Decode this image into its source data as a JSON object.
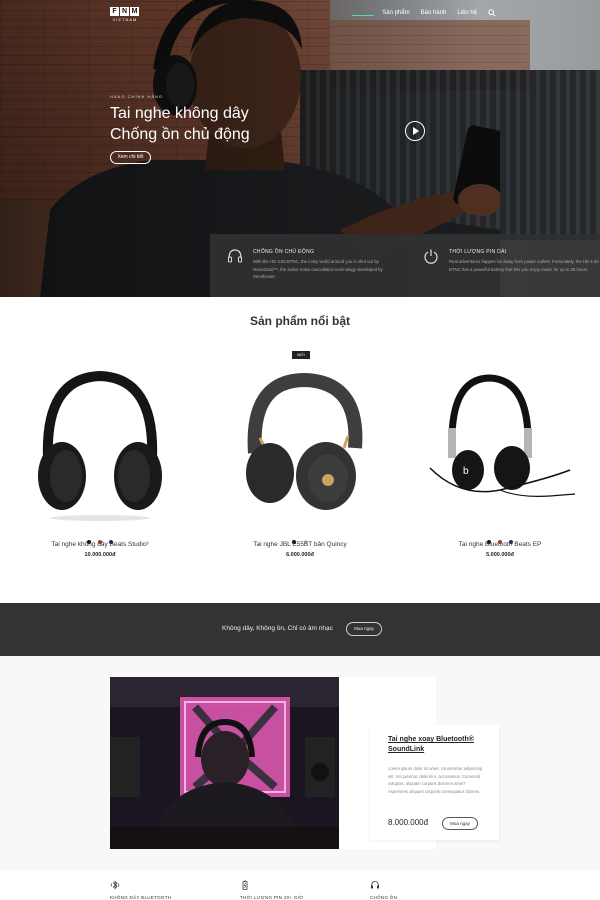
{
  "brand": {
    "logo_letters": [
      "F",
      "N",
      "M"
    ],
    "logo_sub": "VIETNAM"
  },
  "nav": {
    "items": [
      "Sản phẩm",
      "Bảo hành",
      "Liên hệ"
    ]
  },
  "hero": {
    "eyebrow": "HÀNG CHÍNH HÃNG",
    "title_line1": "Tai nghe không dây",
    "title_line2": "Chống ồn chủ động",
    "cta": "Xem chi tiết"
  },
  "hero_features": [
    {
      "icon": "headphones-icon",
      "title": "CHỐNG ỒN CHỦ ĐỘNG",
      "desc": "With the HD 4.50 BTNC, the noisy world around you is shut out by NoiseGard™, the active noise cancellation technology developed by Sennheiser."
    },
    {
      "icon": "power-icon",
      "title": "THỜI LƯỢNG PIN DÀI",
      "desc": "Real adventures happen far away from power outlets. Fortunately, the HD 4.50 BTNC has a powerful battery that lets you enjoy music for up to 25 hours."
    }
  ],
  "products_section": {
    "title": "Sản phẩm nổi bật",
    "badge": "MỚI"
  },
  "products": [
    {
      "name": "Tai nghe không dây Beats Studio³",
      "price": "10.000.000đ",
      "swatches": [
        "#111111",
        "#c0392b",
        "#1f2f6b"
      ]
    },
    {
      "name": "Tai nghe JBL E55BT bản Quincy",
      "price": "6.000.000đ",
      "swatches": [
        "#111111",
        "#e8c7c7"
      ]
    },
    {
      "name": "Tai nghe Bluetooth Beats EP",
      "price": "5.000.000đ",
      "swatches": [
        "#111111",
        "#c0392b",
        "#1f2f6b"
      ]
    }
  ],
  "banner": {
    "text": "Không dây, Không ồn, Chỉ có âm nhạc",
    "cta": "Mua ngay"
  },
  "featured": {
    "title": "Tai nghe xoay Bluetooth® SoundLink",
    "desc": "Lorem ipsum dolor sit amet, consectetur adipiscing elit. Vel pulvinar, deleniti n, accusamus. Commodi voluptas, aliquam corporis dolorem amet? Asperiores aliquam corporis consequatur dolores.",
    "price": "8.000.000đ",
    "cta": "Mua ngay"
  },
  "bottom_features": [
    {
      "icon": "bluetooth-icon",
      "label": "KHÔNG DÂY BLUETOOTH"
    },
    {
      "icon": "battery-icon",
      "label": "THỜI LƯỢNG PIN 20+ GIỜ"
    },
    {
      "icon": "headphones-icon",
      "label": "CHỐNG ỒN"
    }
  ]
}
